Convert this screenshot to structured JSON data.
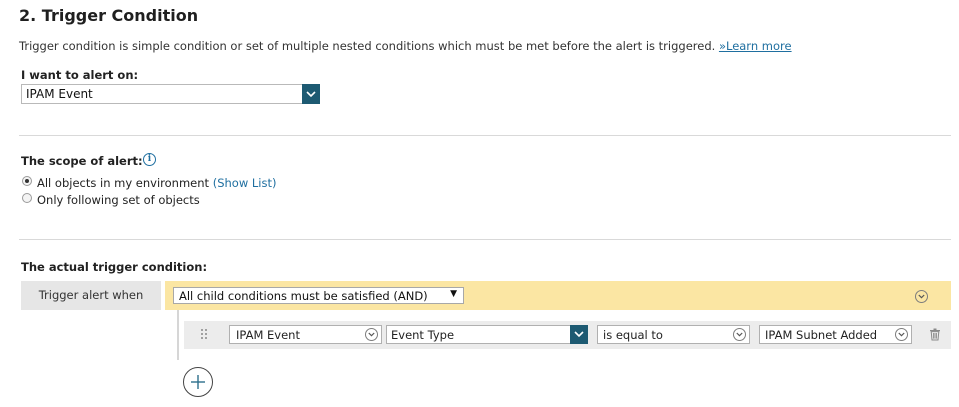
{
  "section": {
    "title": "2. Trigger Condition",
    "description": "Trigger condition is simple condition or set of multiple nested conditions which must be met before the alert is triggered.",
    "learn_more_prefix": "»",
    "learn_more_label": "Learn more"
  },
  "alert_on": {
    "label": "I want to alert on:",
    "value": "IPAM Event"
  },
  "scope": {
    "label": "The scope of alert:",
    "options": [
      {
        "label": "All objects in my environment",
        "link": "(Show List)",
        "selected": true
      },
      {
        "label": "Only following set of objects",
        "selected": false
      }
    ]
  },
  "trigger": {
    "label": "The actual trigger condition:",
    "when_label": "Trigger alert when",
    "logic_value": "All child conditions must be satisfied (AND)",
    "condition": {
      "object": "IPAM Event",
      "field": "Event Type",
      "operator": "is equal to",
      "value": "IPAM Subnet Added"
    }
  },
  "colors": {
    "accent": "#1d5a72",
    "link": "#1f6fa0",
    "highlight": "#fbe6a3",
    "panel": "#e6e6e6"
  },
  "icons": [
    "chevron-down-icon",
    "info-icon",
    "drag-handle-icon",
    "trash-icon",
    "plus-icon"
  ]
}
